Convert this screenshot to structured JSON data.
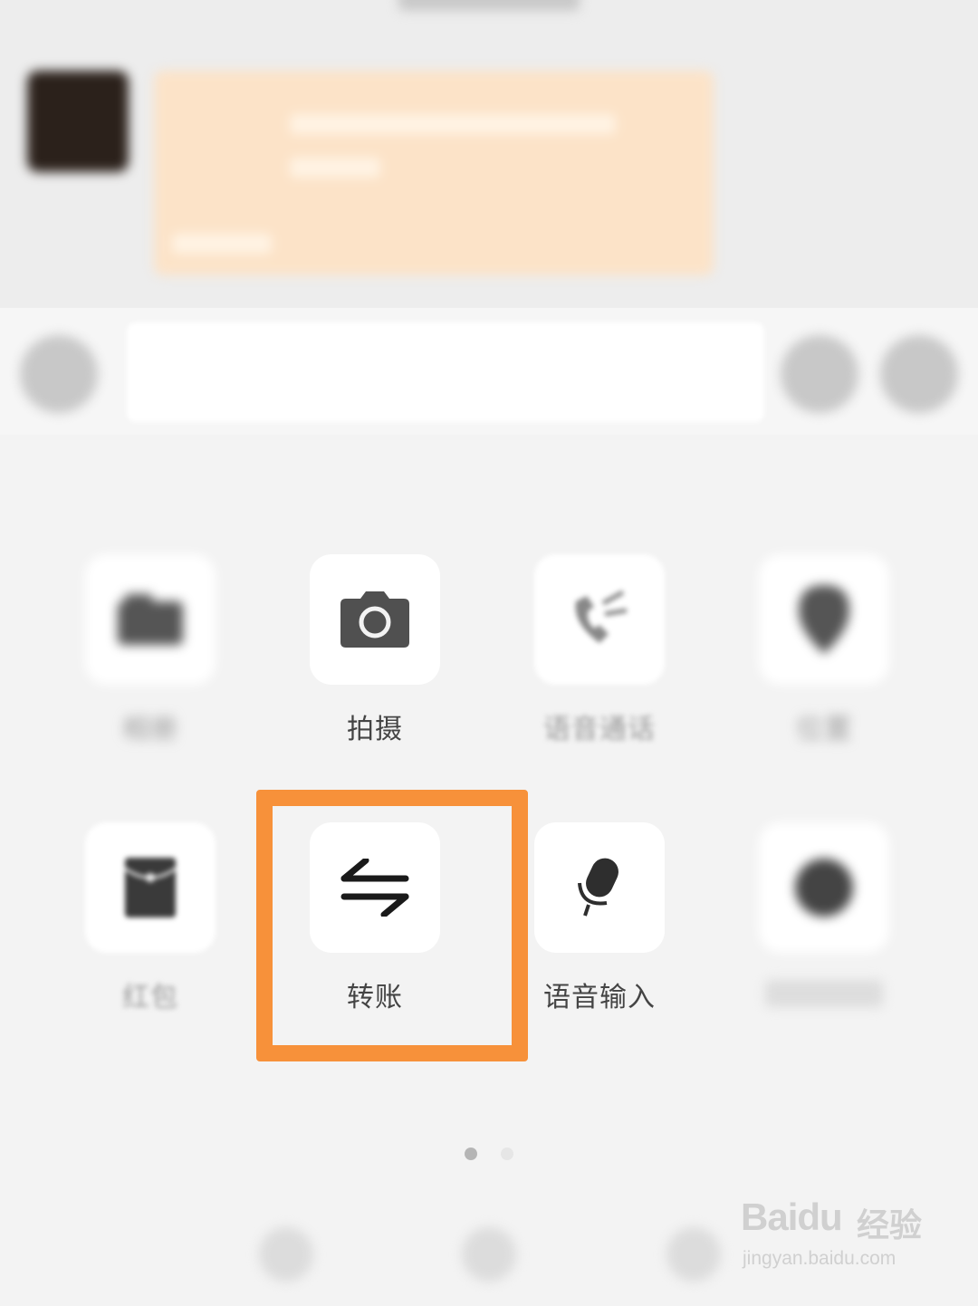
{
  "chat": {
    "title": "",
    "bubble_text": ""
  },
  "input": {
    "placeholder": ""
  },
  "tools": [
    {
      "label": "相册",
      "icon": "photo-album-icon"
    },
    {
      "label": "拍摄",
      "icon": "camera-icon"
    },
    {
      "label": "语音通话",
      "icon": "voice-call-icon"
    },
    {
      "label": "位置",
      "icon": "location-icon"
    },
    {
      "label": "红包",
      "icon": "red-packet-icon"
    },
    {
      "label": "转账",
      "icon": "transfer-icon"
    },
    {
      "label": "语音输入",
      "icon": "microphone-icon"
    },
    {
      "label": "",
      "icon": "favorites-icon"
    }
  ],
  "highlight": {
    "color": "#f7913a",
    "target": "转账"
  },
  "pager": {
    "pages": 2,
    "current": 1
  },
  "watermark": {
    "brand": "Bai",
    "brand2": "du",
    "product": "经验",
    "url": "jingyan.baidu.com"
  }
}
